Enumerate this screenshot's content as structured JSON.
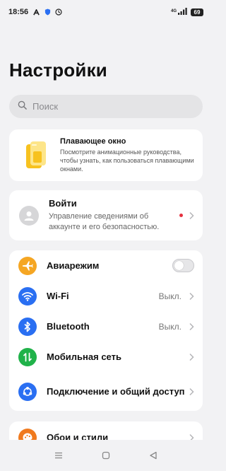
{
  "status_bar": {
    "time": "18:56",
    "network": "4G",
    "battery": "69",
    "icons": [
      "a-icon",
      "shield-icon",
      "clock-icon",
      "signal-icon",
      "battery-icon"
    ]
  },
  "page": {
    "title": "Настройки"
  },
  "search": {
    "placeholder": "Поиск"
  },
  "floating_window": {
    "title": "Плавающее окно",
    "description": "Посмотрите анимационные руководства, чтобы узнать, как пользоваться плавающими окнами."
  },
  "account": {
    "title": "Войти",
    "description": "Управление сведениями об аккаунте и его безопасностью."
  },
  "settings": [
    {
      "label": "Авиарежим",
      "icon": "airplane-icon",
      "color": "#f5a623",
      "toggle": false,
      "value": ""
    },
    {
      "label": "Wi-Fi",
      "icon": "wifi-icon",
      "color": "#2a6ff2",
      "value": "Выкл."
    },
    {
      "label": "Bluetooth",
      "icon": "bluetooth-icon",
      "color": "#2a6ff2",
      "value": "Выкл."
    },
    {
      "label": "Мобильная сеть",
      "icon": "mobile-network-icon",
      "color": "#20b24a",
      "value": ""
    },
    {
      "label": "Подключение и общий доступ",
      "icon": "connection-sharing-icon",
      "color": "#2a6ff2",
      "value": ""
    }
  ],
  "wallpaper": {
    "label": "Обои и стили",
    "icon": "palette-icon",
    "color": "#f07a1e"
  },
  "nav": [
    "menu-icon",
    "home-icon",
    "back-icon"
  ]
}
